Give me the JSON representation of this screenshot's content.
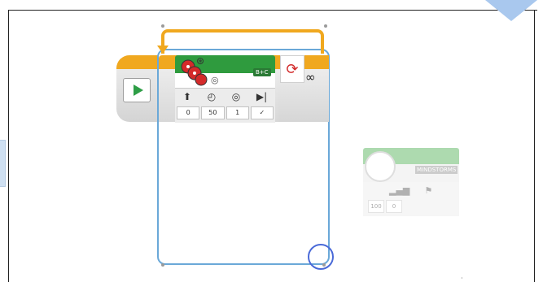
{
  "motor": {
    "port": "B+C",
    "param_icons": [
      "⬆",
      "◴",
      "◎",
      "▶|"
    ],
    "values": [
      "0",
      "50",
      "1",
      "✓"
    ]
  },
  "loop": {
    "repeat_icon": "⟳",
    "mode": "∞"
  },
  "ghost": {
    "label": "MINDSTORMS",
    "param_icons": [
      "▂▄▆",
      "⚑"
    ],
    "values": [
      "100",
      "0"
    ]
  },
  "colors": {
    "accent_orange": "#f0a81f",
    "motor_green": "#2f9b3e",
    "loop_outline": "#6aa8d8",
    "selection_ring": "#4a6ad8"
  }
}
